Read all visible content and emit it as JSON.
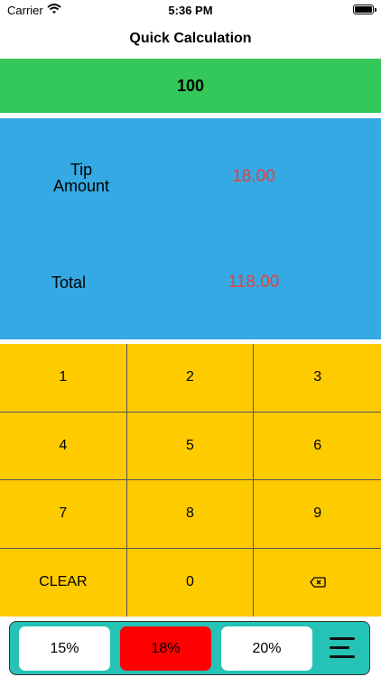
{
  "status_bar": {
    "carrier": "Carrier",
    "time": "5:36 PM"
  },
  "nav": {
    "title": "Quick Calculation"
  },
  "amount": {
    "value": "100"
  },
  "results": {
    "tip_label": "Tip\nAmount",
    "tip_value": "18.00",
    "total_label": "Total",
    "total_value": "118.00",
    "value_color": "#e8403c"
  },
  "keypad": {
    "keys": [
      "1",
      "2",
      "3",
      "4",
      "5",
      "6",
      "7",
      "8",
      "9",
      "CLEAR",
      "0",
      "⌫"
    ]
  },
  "tip_options": {
    "options": [
      "15%",
      "18%",
      "20%"
    ],
    "selected": "18%"
  },
  "colors": {
    "amount_bg": "#34c759",
    "results_bg": "#35a9e3",
    "keypad_bg": "#fecb00",
    "tip_bar_bg": "#25c2b6",
    "selected_tip": "#ff0000"
  },
  "icons": {
    "menu": "hamburger-menu-icon",
    "backspace": "backspace-icon",
    "wifi": "wifi-icon",
    "battery": "battery-icon"
  }
}
